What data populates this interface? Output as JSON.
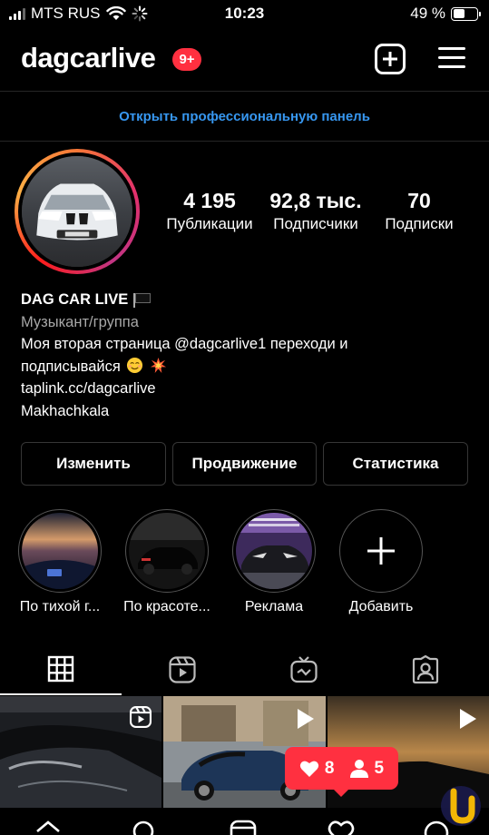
{
  "status_bar": {
    "carrier": "MTS RUS",
    "time": "10:23",
    "battery_percent": "49 %",
    "battery_level": 0.49
  },
  "header": {
    "username": "dagcarlive",
    "notification_badge": "9+"
  },
  "pro_panel": {
    "label": "Открыть профессиональную панель"
  },
  "stats": [
    {
      "value": "4 195",
      "label": "Публикации"
    },
    {
      "value": "92,8 тыс.",
      "label": "Подписчики"
    },
    {
      "value": "70",
      "label": "Подписки"
    }
  ],
  "bio": {
    "name": "DAG CAR LIVE",
    "category": "Музыкант/группа",
    "line1": "Моя вторая страница  @dagcarlive1   переходи и",
    "line2": "подписывайся",
    "link": "taplink.cc/dagcarlive",
    "location": "Makhachkala"
  },
  "buttons": {
    "edit": "Изменить",
    "promote": "Продвижение",
    "insights": "Статистика"
  },
  "highlights": [
    {
      "label": "По тихой г..."
    },
    {
      "label": "По красоте..."
    },
    {
      "label": "Реклама"
    },
    {
      "label": "Добавить"
    }
  ],
  "tabs": [
    "grid-icon",
    "reels-icon",
    "igtv-icon",
    "tagged-icon"
  ],
  "activity_popup": {
    "likes": "8",
    "followers": "5"
  },
  "colors": {
    "accent_blue": "#3797f0",
    "badge_red": "#ff3040",
    "muted_text": "#a8a8a8",
    "border": "#363636"
  }
}
